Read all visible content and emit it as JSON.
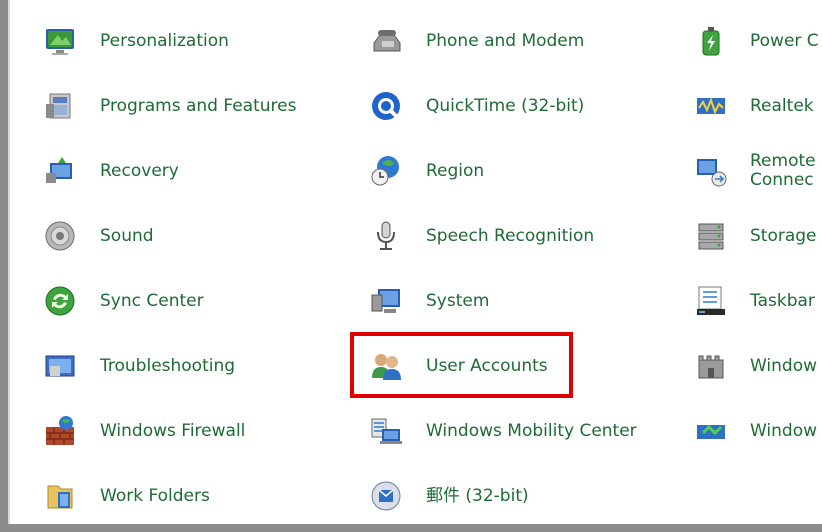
{
  "items": {
    "personalization": "Personalization",
    "phone_modem": "Phone and Modem",
    "power": "Power C",
    "programs": "Programs and Features",
    "quicktime": "QuickTime (32-bit)",
    "realtek": "Realtek",
    "recovery": "Recovery",
    "region": "Region",
    "remote_line1": "Remote",
    "remote_line2": "Connec",
    "sound": "Sound",
    "speech": "Speech Recognition",
    "storage": "Storage",
    "sync": "Sync Center",
    "system": "System",
    "taskbar": "Taskbar",
    "troubleshooting": "Troubleshooting",
    "user_accounts": "User Accounts",
    "windows_a": "Window",
    "firewall": "Windows Firewall",
    "mobility": "Windows Mobility Center",
    "windows_b": "Window",
    "work_folders": "Work Folders",
    "mail": "郵件 (32-bit)"
  },
  "highlight_color": "#e00000",
  "label_color": "#1e6b35"
}
